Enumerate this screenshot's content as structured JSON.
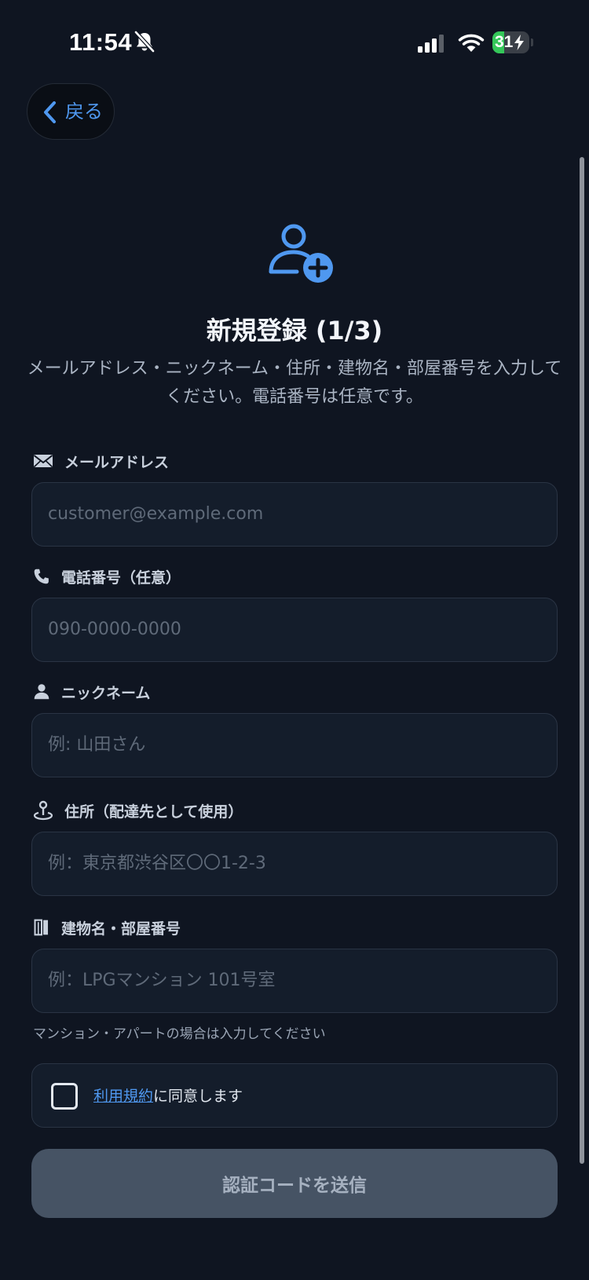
{
  "status_bar": {
    "time": "11:54",
    "battery_level": "31",
    "battery_fraction": 0.31,
    "icons": [
      "bell-off-icon",
      "cellular-signal-icon",
      "wifi-icon",
      "battery-charging-icon"
    ]
  },
  "nav": {
    "back_label": "戻る",
    "back_icon": "chevron-left-icon"
  },
  "header": {
    "icon": "user-plus-icon",
    "title": "新規登録 (1/3)",
    "description_line1": "メールアドレス・ニックネーム・住所・建物名・部屋番号を入力して",
    "description_line2": "ください。電話番号は任意です。"
  },
  "form": {
    "email": {
      "icon": "envelope-icon",
      "label": "メールアドレス",
      "placeholder": "customer@example.com",
      "value": ""
    },
    "phone": {
      "icon": "phone-icon",
      "label": "電話番号（任意）",
      "placeholder": "090-0000-0000",
      "value": ""
    },
    "nickname": {
      "icon": "person-icon",
      "label": "ニックネーム",
      "placeholder": "例: 山田さん",
      "value": ""
    },
    "address": {
      "icon": "map-pin-icon",
      "label": "住所（配達先として使用）",
      "placeholder": "例：東京都渋谷区〇〇1-2-3",
      "value": ""
    },
    "building": {
      "icon": "building-icon",
      "label": "建物名・部屋番号",
      "placeholder": "例：LPGマンション 101号室",
      "value": "",
      "helper": "マンション・アパートの場合は入力してください"
    },
    "terms": {
      "link_text": "利用規約",
      "text": "に同意します",
      "checked": false
    },
    "submit_label": "認証コードを送信"
  },
  "colors": {
    "background": "#0f1521",
    "accent": "#4f98f0",
    "field_background": "#141d2b",
    "button_disabled": "#465364",
    "battery_green": "#34c759"
  }
}
